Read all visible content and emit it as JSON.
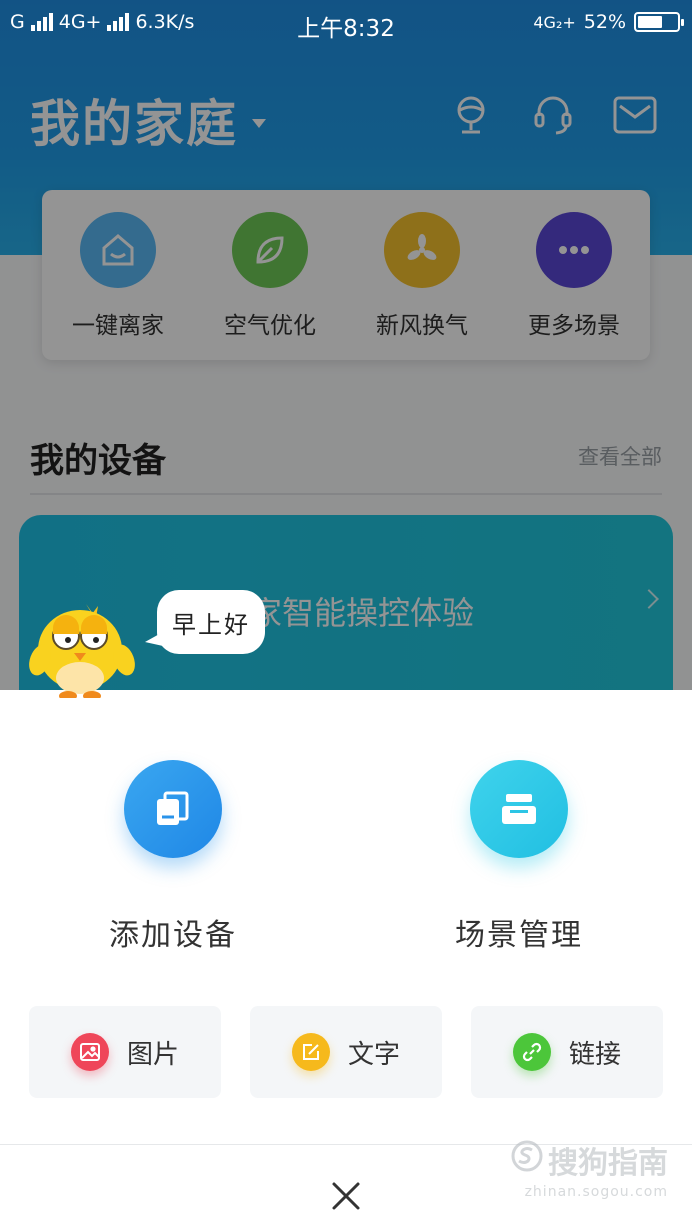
{
  "statusbar": {
    "carrier_left": "G",
    "network": "4G+",
    "speed": "6.3K/s",
    "time": "上午8:32",
    "network_right": "4G₂+",
    "battery": "52%"
  },
  "header": {
    "title": "我的家庭"
  },
  "scenes": [
    {
      "label": "一键离家",
      "color": "#5ab8f5"
    },
    {
      "label": "空气优化",
      "color": "#6fca57"
    },
    {
      "label": "新风换气",
      "color": "#f4c12d"
    },
    {
      "label": "更多场景",
      "color": "#5b47d6"
    }
  ],
  "devices": {
    "title": "我的设备",
    "view_all": "查看全部",
    "promo_text": "家智能操控体验"
  },
  "mascot": {
    "bubble": "早上好"
  },
  "sheet": {
    "actions": [
      {
        "label": "添加设备",
        "icon": "add-device-icon"
      },
      {
        "label": "场景管理",
        "icon": "scene-manage-icon"
      }
    ],
    "share": [
      {
        "label": "图片",
        "color": "#ef4659",
        "icon": "image-icon"
      },
      {
        "label": "文字",
        "color": "#f6b91c",
        "icon": "edit-icon"
      },
      {
        "label": "链接",
        "color": "#4cc63a",
        "icon": "link-icon"
      }
    ]
  },
  "watermark": {
    "main": "搜狗指南",
    "sub": "zhinan.sogou.com"
  }
}
